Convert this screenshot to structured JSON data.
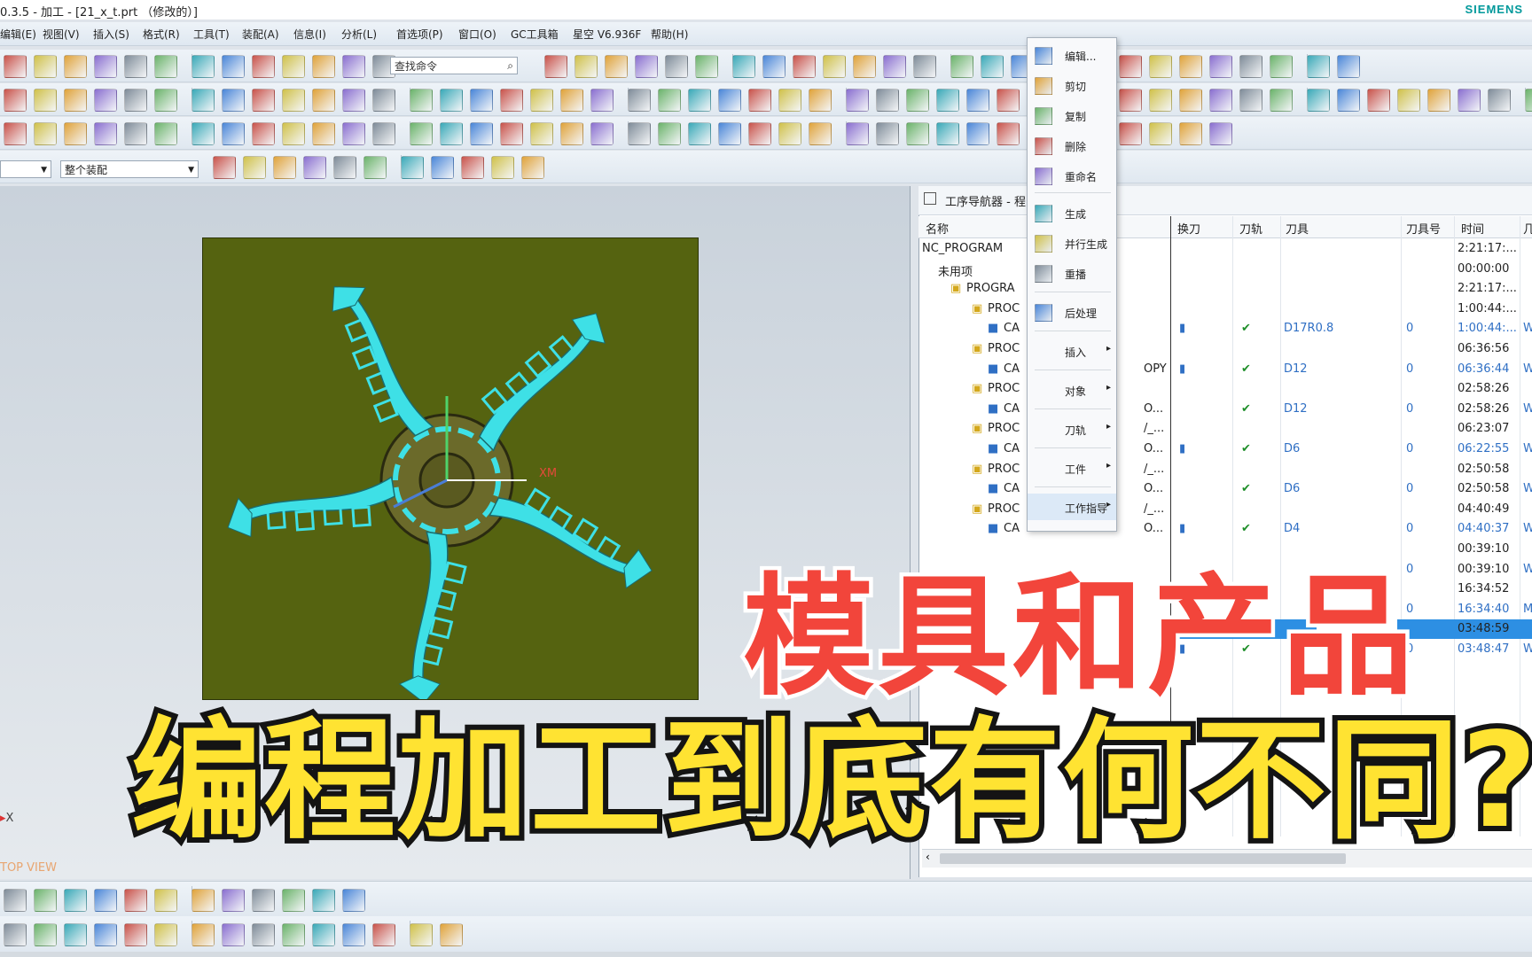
{
  "window": {
    "title": "0.3.5 - 加工 - [21_x_t.prt （修改的）]",
    "brand": "SIEMENS"
  },
  "menubar": [
    "编辑(E)",
    "视图(V)",
    "插入(S)",
    "格式(R)",
    "工具(T)",
    "装配(A)",
    "信息(I)",
    "分析(L)",
    "首选项(P)",
    "窗口(O)",
    "GC工具箱",
    "星空 V6.936F",
    "帮助(H)"
  ],
  "toolbar": {
    "search_placeholder": "查找命令",
    "filter_value": "",
    "assembly_value": "整个装配"
  },
  "viewport": {
    "axis_label": "X",
    "view_label": "TOP VIEW",
    "wcs_label": "XM"
  },
  "navigator": {
    "title": "工序导航器 - 程",
    "columns": [
      "名称",
      "换刀",
      "刀轨",
      "刀具",
      "刀具号",
      "时间",
      "几"
    ],
    "rows": [
      {
        "name": "NC_PROGRAM",
        "suffix": "",
        "tool": "",
        "num": "",
        "time": "2:21:17:...",
        "path": false,
        "chg": false,
        "blue": false
      },
      {
        "name": "未用项",
        "suffix": "",
        "tool": "",
        "num": "",
        "time": "00:00:00",
        "path": false,
        "chg": false,
        "blue": false
      },
      {
        "name": "PROGRA",
        "suffix": "",
        "tool": "",
        "num": "",
        "time": "2:21:17:...",
        "path": false,
        "chg": false,
        "blue": false
      },
      {
        "name": "PROC",
        "suffix": "",
        "tool": "",
        "num": "",
        "time": "1:00:44:...",
        "path": false,
        "chg": false,
        "blue": false
      },
      {
        "name": "CA",
        "suffix": "",
        "tool": "D17R0.8",
        "num": "0",
        "time": "1:00:44:...",
        "path": true,
        "chg": true,
        "blue": true,
        "extra": "W"
      },
      {
        "name": "PROC",
        "suffix": "",
        "tool": "",
        "num": "",
        "time": "06:36:56",
        "path": false,
        "chg": false,
        "blue": false
      },
      {
        "name": "CA",
        "suffix": "OPY",
        "tool": "D12",
        "num": "0",
        "time": "06:36:44",
        "path": true,
        "chg": true,
        "blue": true,
        "extra": "W"
      },
      {
        "name": "PROC",
        "suffix": "",
        "tool": "",
        "num": "",
        "time": "02:58:26",
        "path": false,
        "chg": false,
        "blue": false
      },
      {
        "name": "CA",
        "suffix": "O...",
        "tool": "D12",
        "num": "0",
        "time": "02:58:26",
        "path": true,
        "chg": false,
        "blue": false,
        "extra": "W"
      },
      {
        "name": "PROC",
        "suffix": "/_...",
        "tool": "",
        "num": "",
        "time": "06:23:07",
        "path": false,
        "chg": false,
        "blue": false
      },
      {
        "name": "CA",
        "suffix": "O...",
        "tool": "D6",
        "num": "0",
        "time": "06:22:55",
        "path": true,
        "chg": true,
        "blue": true,
        "extra": "W"
      },
      {
        "name": "PROC",
        "suffix": "/_...",
        "tool": "",
        "num": "",
        "time": "02:50:58",
        "path": false,
        "chg": false,
        "blue": false
      },
      {
        "name": "CA",
        "suffix": "O...",
        "tool": "D6",
        "num": "0",
        "time": "02:50:58",
        "path": true,
        "chg": false,
        "blue": false,
        "extra": "W"
      },
      {
        "name": "PROC",
        "suffix": "/_...",
        "tool": "",
        "num": "",
        "time": "04:40:49",
        "path": false,
        "chg": false,
        "blue": false
      },
      {
        "name": "CA",
        "suffix": "O...",
        "tool": "D4",
        "num": "0",
        "time": "04:40:37",
        "path": true,
        "chg": true,
        "blue": true,
        "extra": "W"
      },
      {
        "name": "",
        "suffix": "",
        "tool": "",
        "num": "",
        "time": "00:39:10",
        "path": false,
        "chg": false,
        "blue": false
      },
      {
        "name": "",
        "suffix": "",
        "tool": "",
        "num": "0",
        "time": "00:39:10",
        "path": false,
        "chg": false,
        "blue": false,
        "extra": "W"
      },
      {
        "name": "",
        "suffix": "",
        "tool": "",
        "num": "",
        "time": "16:34:52",
        "path": false,
        "chg": false,
        "blue": false
      },
      {
        "name": "",
        "suffix": "",
        "tool": "",
        "num": "0",
        "time": "16:34:40",
        "path": false,
        "chg": false,
        "blue": true,
        "extra": "M"
      },
      {
        "name": "",
        "suffix": "",
        "tool": "",
        "num": "",
        "time": "03:48:59",
        "path": false,
        "chg": false,
        "blue": false,
        "selected": true
      },
      {
        "name": "",
        "suffix": "",
        "tool": "",
        "num": "0",
        "time": "03:48:47",
        "path": true,
        "chg": true,
        "blue": true,
        "extra": "W"
      }
    ]
  },
  "context_menu": [
    {
      "label": "编辑...",
      "icon": "edit-icon"
    },
    {
      "label": "剪切",
      "icon": "cut-icon"
    },
    {
      "label": "复制",
      "icon": "copy-icon"
    },
    {
      "label": "删除",
      "icon": "delete-icon"
    },
    {
      "label": "重命名",
      "icon": "rename-icon"
    },
    {
      "label": "生成",
      "icon": "generate-icon"
    },
    {
      "label": "并行生成",
      "icon": "parallel-generate-icon"
    },
    {
      "label": "重播",
      "icon": "replay-icon"
    },
    {
      "label": "后处理",
      "icon": "postprocess-icon"
    },
    {
      "label": "插入",
      "icon": "",
      "submenu": true
    },
    {
      "label": "对象",
      "icon": "",
      "submenu": true
    },
    {
      "label": "刀轨",
      "icon": "",
      "submenu": true
    },
    {
      "label": "工件",
      "icon": "",
      "submenu": true
    },
    {
      "label": "工作指导",
      "icon": "",
      "submenu": true
    }
  ],
  "overlay": {
    "line1": "模具和产品",
    "line2": "编程加工到底有何不同?"
  },
  "colors": {
    "part": "#556310",
    "toolpath": "#3ee0e6",
    "selection": "#2d8fe3",
    "overlay_red": "#f2453b",
    "overlay_yellow": "#ffe332"
  }
}
